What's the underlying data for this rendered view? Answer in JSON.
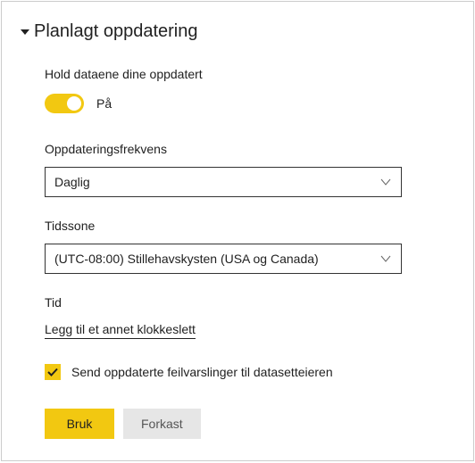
{
  "section": {
    "title": "Planlagt oppdatering"
  },
  "keepData": {
    "label": "Hold dataene dine oppdatert",
    "stateLabel": "På"
  },
  "frequency": {
    "label": "Oppdateringsfrekvens",
    "value": "Daglig"
  },
  "timezone": {
    "label": "Tidssone",
    "value": "(UTC-08:00) Stillehavskysten (USA og Canada)"
  },
  "time": {
    "label": "Tid",
    "addLink": "Legg til et annet klokkeslett"
  },
  "notify": {
    "label": "Send oppdaterte feilvarslinger til datasetteieren"
  },
  "buttons": {
    "apply": "Bruk",
    "discard": "Forkast"
  }
}
